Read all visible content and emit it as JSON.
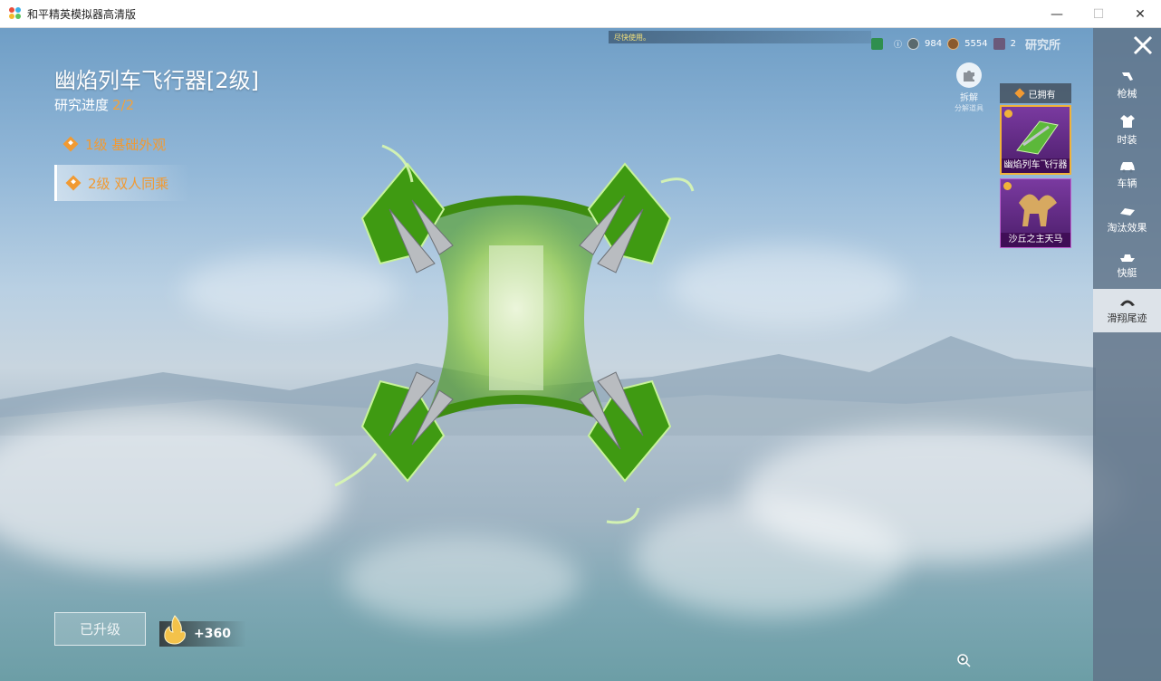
{
  "window": {
    "title": "和平精英模拟器高清版",
    "minimize": "—",
    "maximize": "☐",
    "close": "✕"
  },
  "notice": {
    "text": "尽快使用。"
  },
  "currency": {
    "items": [
      {
        "icon": "green-gem-icon",
        "value": ""
      },
      {
        "icon": "silver-coin-icon",
        "value": "984"
      },
      {
        "icon": "bronze-coin-icon",
        "value": "5554"
      },
      {
        "icon": "ticket-icon",
        "value": "2"
      }
    ],
    "lab_title": "研究所"
  },
  "item": {
    "title": "幽焰列车飞行器[2级]",
    "progress_label": "研究进度",
    "progress_value": "2/2",
    "levels": [
      {
        "label": "1级 基础外观",
        "active": false
      },
      {
        "label": "2级 双人同乘",
        "active": true
      }
    ]
  },
  "dismantle": {
    "label": "拆解",
    "sub": "分解道具"
  },
  "owned": {
    "header": "已拥有",
    "cards": [
      {
        "name": "幽焰列车飞行器",
        "selected": true
      },
      {
        "name": "沙丘之主天马",
        "selected": false
      }
    ]
  },
  "sidebar": {
    "items": [
      {
        "label": "枪械",
        "icon": "gun-icon"
      },
      {
        "label": "时装",
        "icon": "outfit-icon"
      },
      {
        "label": "车辆",
        "icon": "car-icon"
      },
      {
        "label": "淘汰效果",
        "icon": "elimination-effect-icon"
      },
      {
        "label": "快艇",
        "icon": "speedboat-icon"
      },
      {
        "label": "滑翔尾迹",
        "icon": "glider-trail-icon",
        "active": true
      }
    ]
  },
  "bottom": {
    "upgraded_label": "已升级",
    "reward_value": "+360"
  },
  "colors": {
    "accent_orange": "#f19a32",
    "sidebar_bg": "#5f7387",
    "card_purple": "#7a3aa0",
    "glider_green": "#4caf1e"
  }
}
